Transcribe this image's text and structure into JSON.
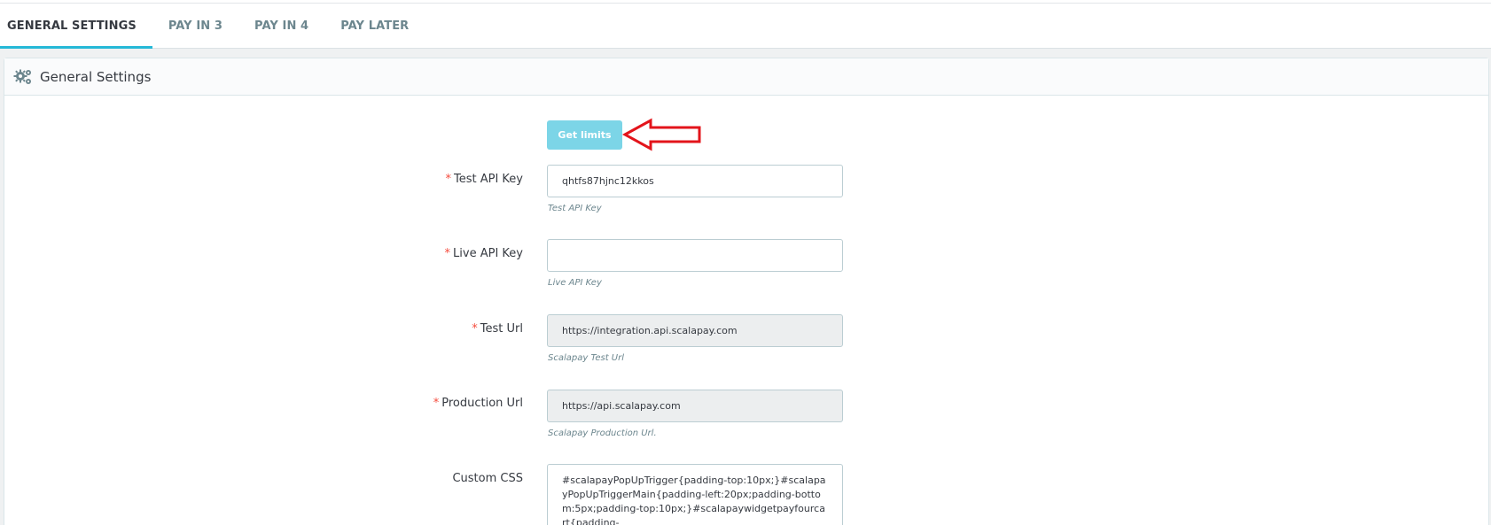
{
  "tabs": [
    {
      "label": "GENERAL SETTINGS",
      "active": true
    },
    {
      "label": "PAY IN 3",
      "active": false
    },
    {
      "label": "PAY IN 4",
      "active": false
    },
    {
      "label": "PAY LATER",
      "active": false
    }
  ],
  "panel": {
    "icon": "gears-icon",
    "title": "General Settings"
  },
  "get_limits_button": "Get limits",
  "annotation": {
    "icon": "red-arrow-icon",
    "color": "#e3141b"
  },
  "fields": {
    "test_api_key": {
      "label": "Test API Key",
      "required": "*",
      "value": "qhtfs87hjnc12kkos",
      "help": "Test API Key"
    },
    "live_api_key": {
      "label": "Live API Key",
      "required": "*",
      "value": "",
      "help": "Live API Key"
    },
    "test_url": {
      "label": "Test Url",
      "required": "*",
      "value": "https://integration.api.scalapay.com",
      "help": "Scalapay Test Url"
    },
    "production_url": {
      "label": "Production Url",
      "required": "*",
      "value": "https://api.scalapay.com",
      "help": "Scalapay Production Url."
    },
    "custom_css": {
      "label": "Custom CSS",
      "value": "#scalapayPopUpTrigger{padding-top:10px;}#scalapayPopUpTriggerMain{padding-left:20px;padding-bottom:5px;padding-top:10px;}#scalapaywidgetpayfourcart{padding-"
    }
  },
  "colors": {
    "accent": "#25b9d7",
    "button": "#7cd5e7",
    "required": "#f54c3e"
  }
}
